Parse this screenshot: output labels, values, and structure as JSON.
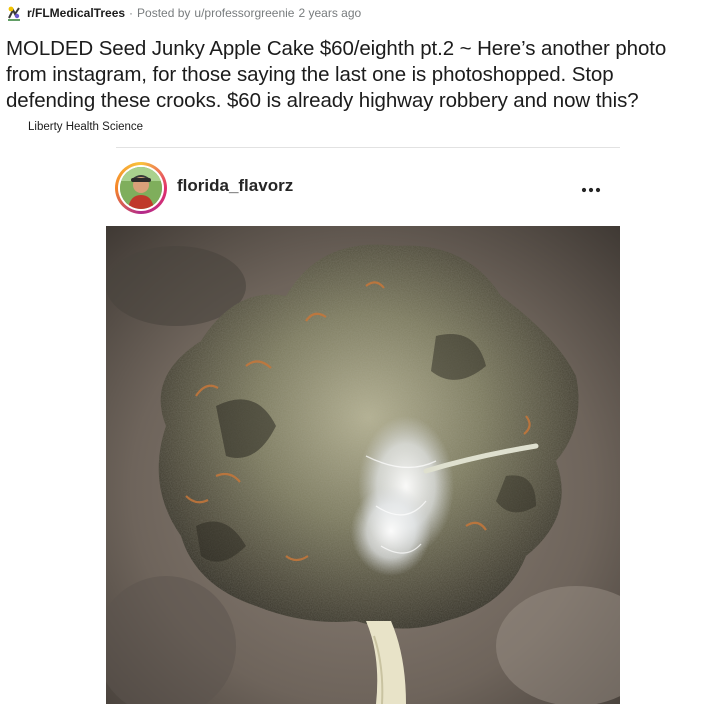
{
  "post": {
    "subreddit": "r/FLMedicalTrees",
    "separator": "·",
    "posted_by_prefix": "Posted by",
    "author": "u/professorgreenie",
    "age": "2 years ago",
    "title": "MOLDED Seed Junky Apple Cake $60/eighth pt.2 ~ Here’s another photo from instagram, for those saying the last one is photoshopped. Stop defending these crooks. $60 is already highway robbery and now this?",
    "flair": "Liberty Health Science"
  },
  "embed": {
    "username": "florida_flavorz",
    "more_icon": "more-horizontal-icon",
    "avatar_icon": "profile-avatar"
  },
  "colors": {
    "muted_text": "#787c7e",
    "title_text": "#1c1c1c",
    "ig_username": "#262626"
  }
}
